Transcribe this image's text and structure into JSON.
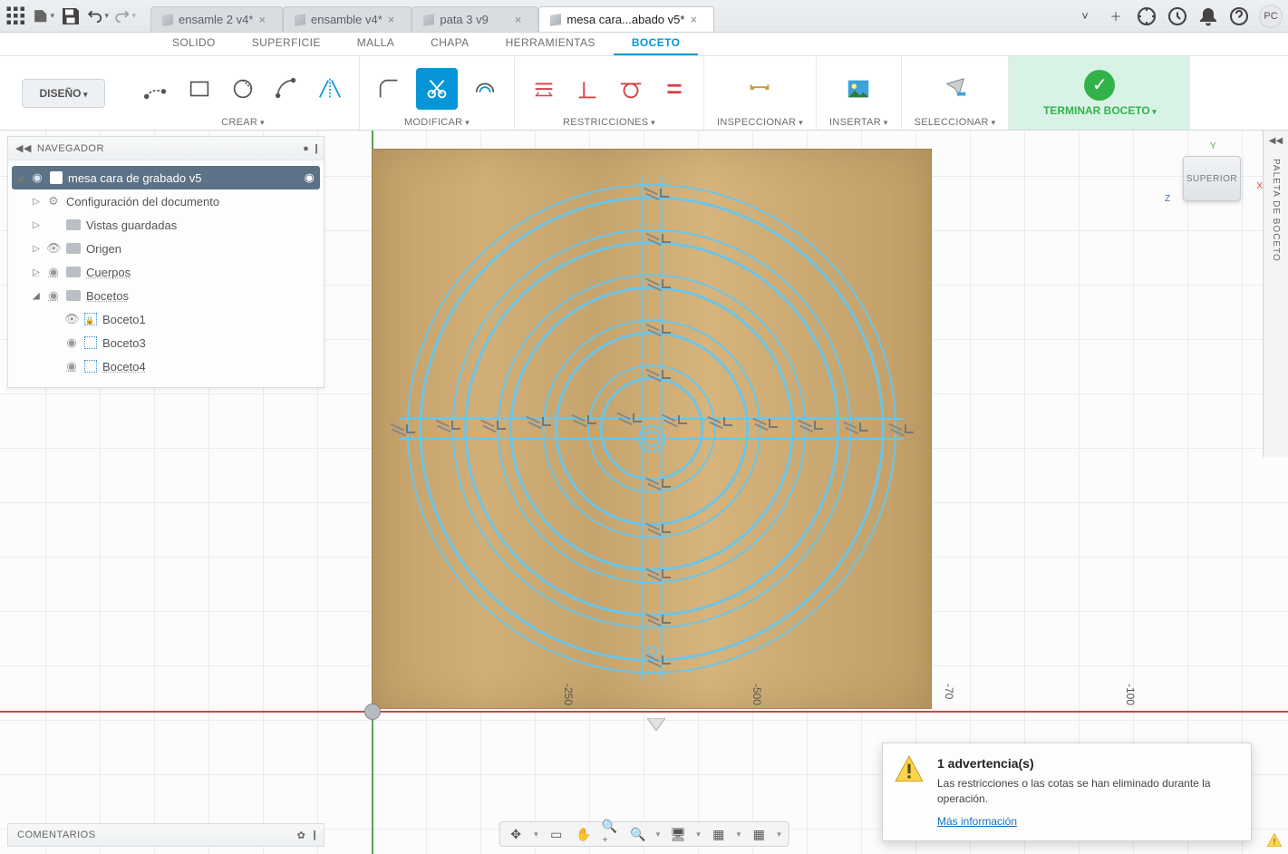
{
  "topbar": {
    "tabs": [
      {
        "label": "ensamle 2 v4*"
      },
      {
        "label": "ensamble v4*"
      },
      {
        "label": "pata 3 v9"
      },
      {
        "label": "mesa cara...abado v5*",
        "active": true
      }
    ],
    "avatar": "PC"
  },
  "ribbonTabs": {
    "items": [
      "SOLIDO",
      "SUPERFICIE",
      "MALLA",
      "CHAPA",
      "HERRAMIENTAS",
      "BOCETO"
    ],
    "activeIndex": 5
  },
  "ribbon": {
    "designButton": "DISEÑO",
    "groups": {
      "create": "CREAR",
      "modify": "MODIFICAR",
      "constraints": "RESTRICCIONES",
      "inspect": "INSPECCIONAR",
      "insert": "INSERTAR",
      "select": "SELECCIONAR",
      "finish": "TERMINAR BOCETO"
    }
  },
  "browser": {
    "title": "NAVEGADOR",
    "root": "mesa cara de grabado v5",
    "nodes": {
      "docConfig": "Configuración del documento",
      "savedViews": "Vistas guardadas",
      "origin": "Origen",
      "bodies": "Cuerpos",
      "sketches": "Bocetos",
      "sk1": "Boceto1",
      "sk3": "Boceto3",
      "sk4": "Boceto4"
    }
  },
  "viewcube": {
    "face": "SUPERIOR",
    "axes": {
      "x": "X",
      "y": "Y",
      "z": "Z"
    }
  },
  "palette": {
    "label": "PALETA DE BOCETO"
  },
  "dims": {
    "d250": "-250",
    "d500": "-500",
    "d700": "-70",
    "d100": "-100"
  },
  "comments": {
    "title": "COMENTARIOS"
  },
  "toast": {
    "title": "1 advertencia(s)",
    "body": "Las restricciones o las cotas se han eliminado durante la operación.",
    "link": "Más información"
  }
}
